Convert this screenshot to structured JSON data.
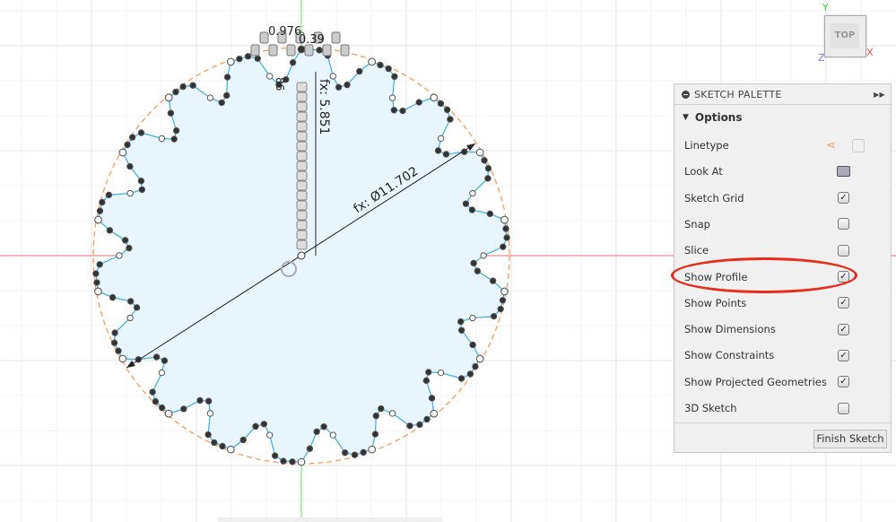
{
  "viewcube": {
    "face": "TOP",
    "axis_x": "X",
    "axis_y": "Y",
    "axis_z": "Z"
  },
  "dimensions": {
    "diameter": "fx: Ø11.702",
    "radius_vertical": "fx: 5.851",
    "cluttered": [
      "0.976",
      "0.39",
      "86"
    ]
  },
  "palette": {
    "title": "SKETCH PALETTE",
    "section": "Options",
    "rows": [
      {
        "label": "Linetype",
        "type": "icons"
      },
      {
        "label": "Look At",
        "type": "icon"
      },
      {
        "label": "Sketch Grid",
        "checked": true
      },
      {
        "label": "Snap",
        "checked": false
      },
      {
        "label": "Slice",
        "checked": false
      },
      {
        "label": "Show Profile",
        "checked": true
      },
      {
        "label": "Show Points",
        "checked": true
      },
      {
        "label": "Show Dimensions",
        "checked": true
      },
      {
        "label": "Show Constraints",
        "checked": true
      },
      {
        "label": "Show Projected Geometries",
        "checked": true
      },
      {
        "label": "3D Sketch",
        "checked": false
      }
    ],
    "finish_label": "Finish Sketch"
  },
  "colors": {
    "x_axis": "#e06060",
    "y_axis": "#5ee05e",
    "profile_fill": "#e9f5fc",
    "profile_stroke": "#4ab0e0",
    "construction": "#f0a060",
    "highlight": "#e8291c"
  }
}
